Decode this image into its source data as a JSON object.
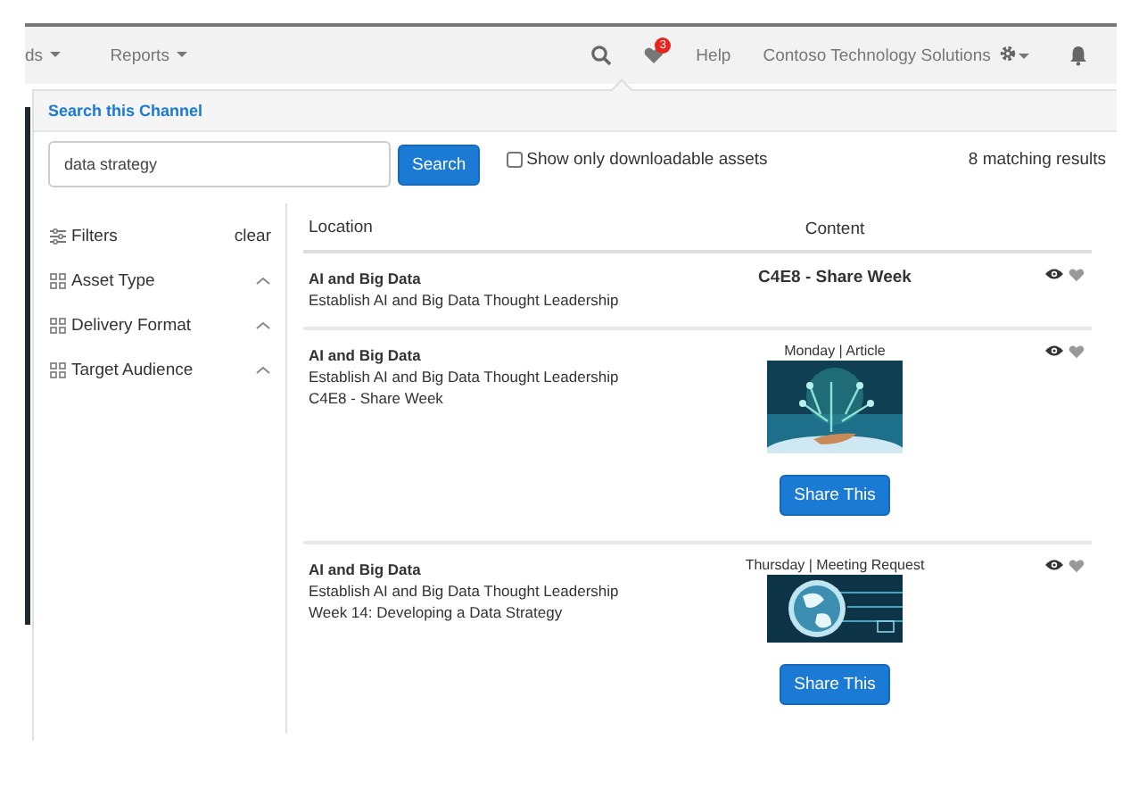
{
  "nav": {
    "cut_item": "ds",
    "reports": "Reports",
    "badge": "3",
    "help": "Help",
    "company": "Contoso Technology Solutions"
  },
  "panel": {
    "title": "Search this Channel"
  },
  "search": {
    "value": "data strategy",
    "button": "Search",
    "checkbox_label": "Show only downloadable assets",
    "checked": false,
    "results": "8 matching results"
  },
  "sidebar": {
    "title": "Filters",
    "clear": "clear",
    "items": [
      {
        "label": "Asset Type",
        "expanded": false
      },
      {
        "label": "Delivery Format",
        "expanded": false
      },
      {
        "label": "Target Audience",
        "expanded": false
      }
    ]
  },
  "table": {
    "columns": [
      "Location",
      "Content"
    ],
    "rows": [
      {
        "kind": "title",
        "location": "AI and Big Data",
        "lines": [
          "Establish AI and Big Data Thought Leadership"
        ],
        "content": "C4E8 - Share Week"
      },
      {
        "kind": "asset",
        "location": "AI and Big Data",
        "lines": [
          "Establish AI and Big Data Thought Leadership",
          "C4E8 - Share Week"
        ],
        "meta": "Monday | Article",
        "button": "Share This"
      },
      {
        "kind": "asset",
        "location": "AI and Big Data",
        "lines": [
          "Establish AI and Big Data Thought Leadership",
          "Week 14: Developing a Data Strategy"
        ],
        "meta": "Thursday | Meeting Request",
        "button": "Share This"
      }
    ]
  }
}
